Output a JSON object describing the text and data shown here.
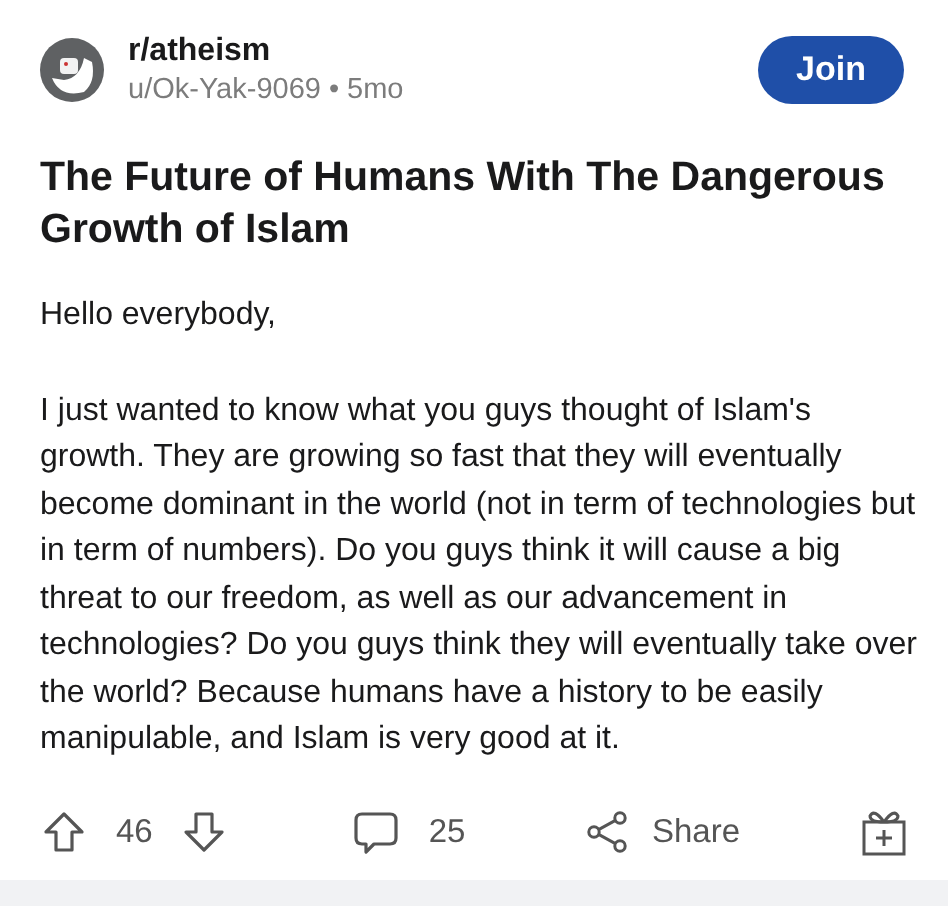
{
  "post": {
    "subreddit": "r/atheism",
    "author": "u/Ok-Yak-9069",
    "separator": "•",
    "age": "5mo",
    "join_label": "Join",
    "title": "The Future of Humans With The Dangerous Growth of Islam",
    "paragraphs": [
      "Hello everybody,",
      "I just wanted to know what you guys thought of Islam's growth. They are growing so fast that they will eventually become dominant in the world (not in term of technologies but in term of numbers). Do you guys think it will cause a big threat to our freedom, as well as our advancement in technologies? Do you guys think they will eventually take over the world? Because humans have a history to be easily manipulable, and Islam is very good at it."
    ]
  },
  "actions": {
    "votes": "46",
    "comments": "25",
    "share_label": "Share"
  }
}
